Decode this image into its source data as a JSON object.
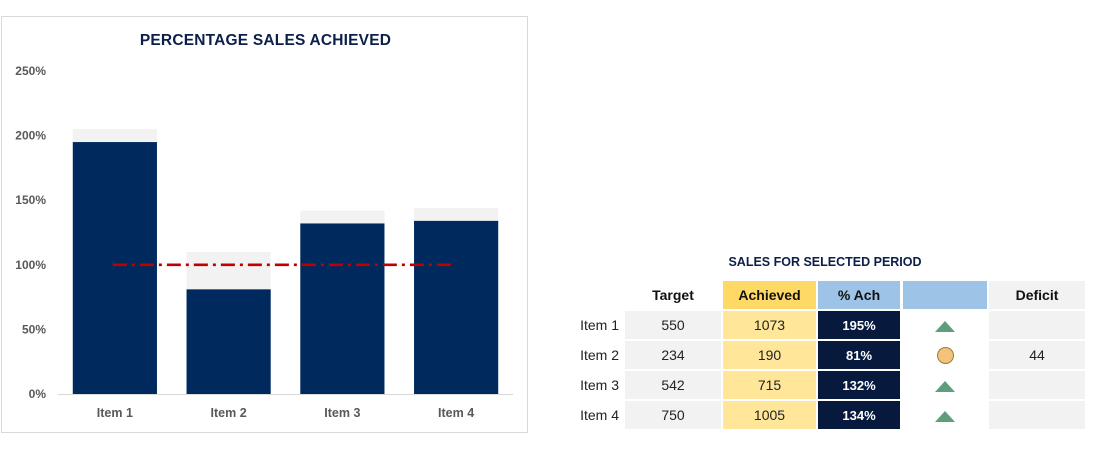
{
  "chart_data": {
    "type": "bar",
    "title": "PERCENTAGE SALES ACHIEVED",
    "categories": [
      "Item 1",
      "Item 2",
      "Item 3",
      "Item 4"
    ],
    "series": [
      {
        "values": [
          195,
          81,
          132,
          134
        ],
        "color": "#002a5e"
      },
      {
        "values": [
          205,
          110,
          142,
          144
        ],
        "color": "#f2f2f2"
      }
    ],
    "target_line": {
      "value": 100,
      "color": "#c00000",
      "style": "dash-dot"
    },
    "ylim": [
      0,
      250
    ],
    "yticks": [
      "0%",
      "50%",
      "100%",
      "150%",
      "200%",
      "250%"
    ],
    "ytick_values": [
      0,
      50,
      100,
      150,
      200,
      250
    ],
    "grid": false,
    "legend": "none"
  },
  "table": {
    "title": "SALES FOR SELECTED PERIOD",
    "headers": {
      "target": "Target",
      "achieved": "Achieved",
      "pct": "% Ach",
      "indicator": "",
      "deficit": "Deficit"
    },
    "rows": [
      {
        "label": "Item 1",
        "target": "550",
        "achieved": "1073",
        "pct": "195%",
        "indicator": "up-triangle-icon",
        "deficit": ""
      },
      {
        "label": "Item 2",
        "target": "234",
        "achieved": "190",
        "pct": "81%",
        "indicator": "circle-icon",
        "deficit": "44"
      },
      {
        "label": "Item 3",
        "target": "542",
        "achieved": "715",
        "pct": "132%",
        "indicator": "up-triangle-icon",
        "deficit": ""
      },
      {
        "label": "Item 4",
        "target": "750",
        "achieved": "1005",
        "pct": "134%",
        "indicator": "up-triangle-icon",
        "deficit": ""
      }
    ]
  },
  "colors": {
    "navy": "#071a3e",
    "gold": "#ffd966",
    "lightblue": "#9dc3e6",
    "up": "#5e9e7f",
    "neutral": "#f4c27a"
  }
}
